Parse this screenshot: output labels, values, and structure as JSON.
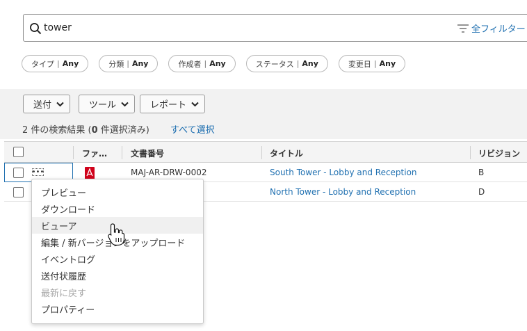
{
  "search": {
    "value": "tower",
    "filter_label": "全フィルター"
  },
  "chips": [
    {
      "label": "タイプ",
      "value": "Any"
    },
    {
      "label": "分類",
      "value": "Any"
    },
    {
      "label": "作成者",
      "value": "Any"
    },
    {
      "label": "ステータス",
      "value": "Any"
    },
    {
      "label": "変更日",
      "value": "Any"
    }
  ],
  "chip_separator": "|",
  "toolbar": {
    "send": "送付",
    "tools": "ツール",
    "report": "レポート"
  },
  "results": {
    "prefix": "2 件の検索結果 (",
    "selected": "0",
    "suffix": " 件選択済み)",
    "select_all": "すべて選択"
  },
  "table": {
    "headers": {
      "file": "ファ…",
      "doc_number": "文書番号",
      "title": "タイトル",
      "revision": "リビジョン"
    },
    "rows": [
      {
        "doc_number": "MAJ-AR-DRW-0002",
        "title": "South Tower - Lobby and Reception",
        "revision": "B"
      },
      {
        "doc_number": "",
        "title": "North Tower - Lobby and Reception",
        "revision": "D"
      }
    ]
  },
  "menu": {
    "items": [
      {
        "label": "プレビュー",
        "state": "normal"
      },
      {
        "label": "ダウンロード",
        "state": "normal"
      },
      {
        "label": "ビューア",
        "state": "hover"
      },
      {
        "label": "編集 / 新バージョンをアップロード",
        "state": "normal"
      },
      {
        "label": "イベントログ",
        "state": "normal"
      },
      {
        "label": "送付状履歴",
        "state": "normal"
      },
      {
        "label": "最新に戻す",
        "state": "disabled"
      },
      {
        "label": "プロパティー",
        "state": "normal"
      }
    ]
  },
  "colors": {
    "link": "#1e6fb0",
    "pdf_red": "#d0021b",
    "toolbar_bg": "#f2f2f2"
  }
}
